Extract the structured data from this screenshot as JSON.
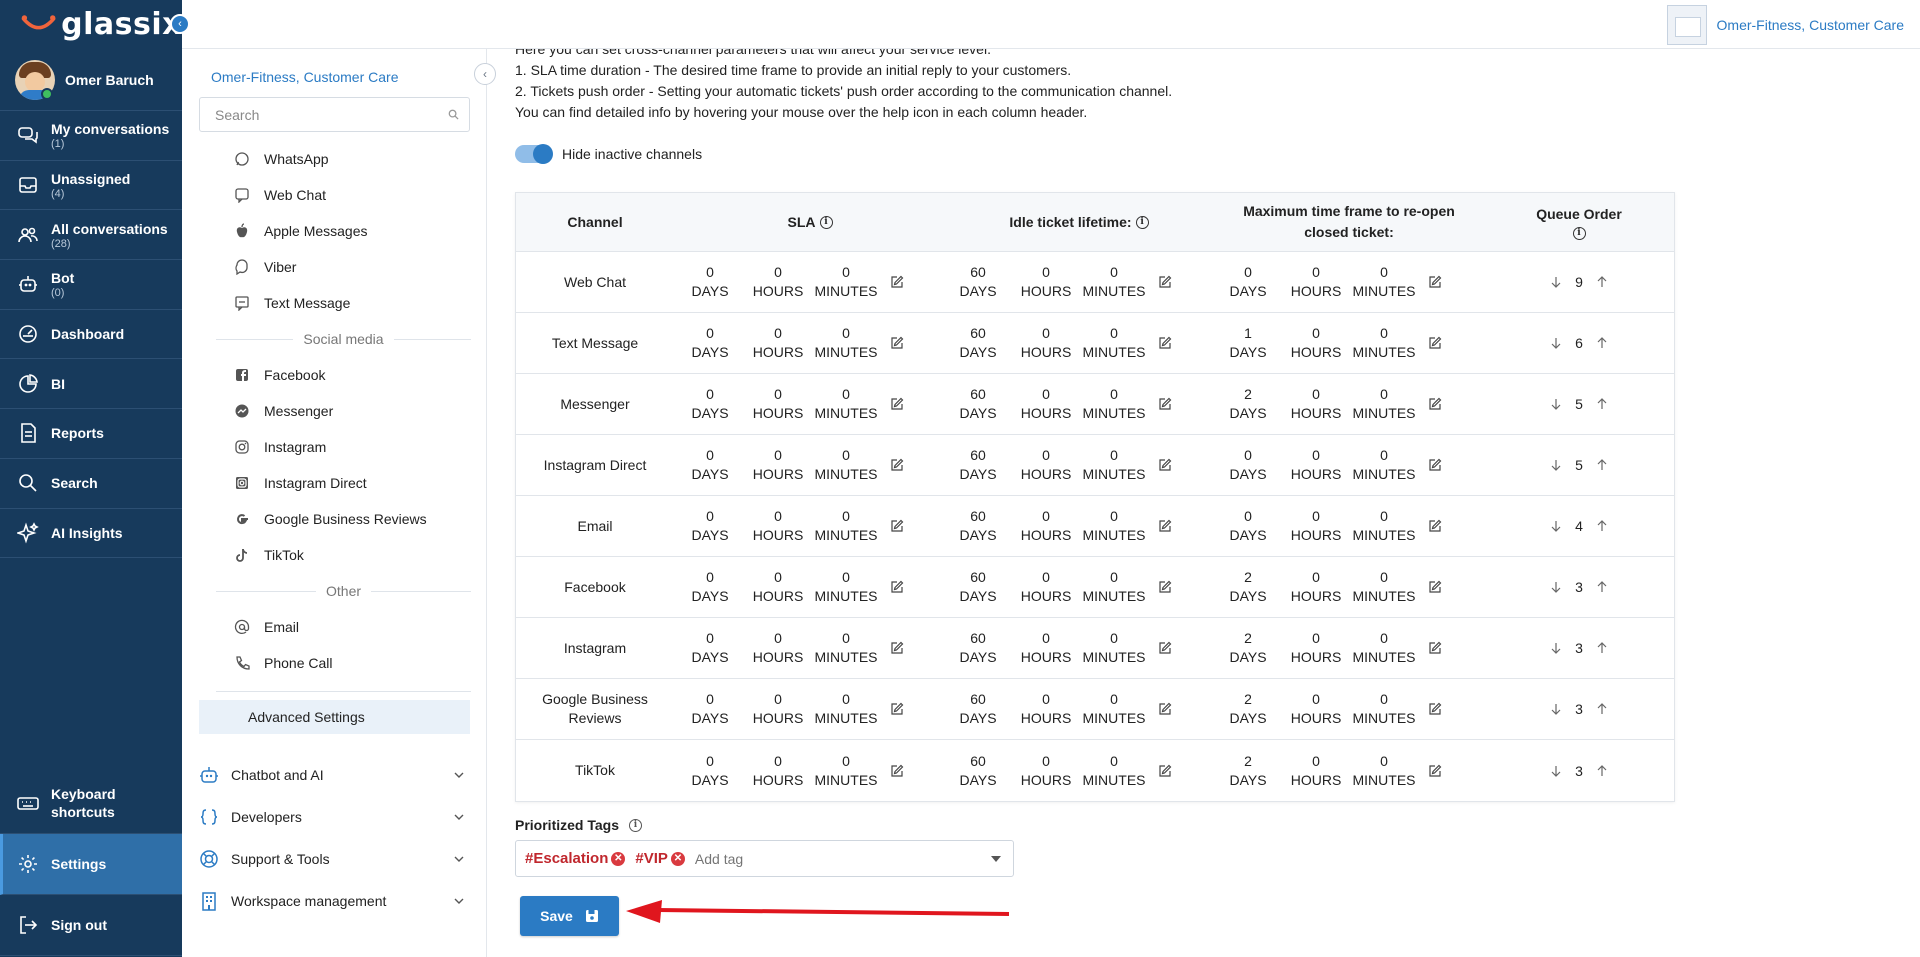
{
  "app": {
    "logo_text": "glassix",
    "org_name": "Omer-Fitness, Customer Care"
  },
  "nav": {
    "user_name": "Omer Baruch",
    "items": [
      {
        "label": "My conversations",
        "count": "(1)",
        "icon": "chat-bubbles-icon"
      },
      {
        "label": "Unassigned",
        "count": "(4)",
        "icon": "inbox-icon"
      },
      {
        "label": "All conversations",
        "count": "(28)",
        "icon": "users-icon"
      },
      {
        "label": "Bot",
        "count": "(0)",
        "icon": "robot-icon"
      },
      {
        "label": "Dashboard",
        "icon": "dashboard-icon"
      },
      {
        "label": "BI",
        "icon": "pie-chart-icon"
      },
      {
        "label": "Reports",
        "icon": "report-icon"
      },
      {
        "label": "Search",
        "icon": "search-icon"
      },
      {
        "label": "AI Insights",
        "icon": "sparkle-icon"
      }
    ],
    "bottom": [
      {
        "label": "Keyboard shortcuts",
        "icon": "keyboard-icon"
      },
      {
        "label": "Settings",
        "icon": "gear-icon",
        "active": true
      },
      {
        "label": "Sign out",
        "icon": "sign-out-icon"
      }
    ]
  },
  "sidebar": {
    "org_name": "Omer-Fitness, Customer Care",
    "search_placeholder": "Search",
    "channels": [
      {
        "label": "WhatsApp",
        "icon": "whatsapp-icon"
      },
      {
        "label": "Web Chat",
        "icon": "web-chat-icon"
      },
      {
        "label": "Apple Messages",
        "icon": "apple-icon"
      },
      {
        "label": "Viber",
        "icon": "viber-icon"
      },
      {
        "label": "Text Message",
        "icon": "sms-icon"
      }
    ],
    "social_title": "Social media",
    "social": [
      {
        "label": "Facebook",
        "icon": "facebook-icon"
      },
      {
        "label": "Messenger",
        "icon": "messenger-icon"
      },
      {
        "label": "Instagram",
        "icon": "instagram-icon"
      },
      {
        "label": "Instagram Direct",
        "icon": "instagram-direct-icon"
      },
      {
        "label": "Google Business Reviews",
        "icon": "google-icon"
      },
      {
        "label": "TikTok",
        "icon": "tiktok-icon"
      }
    ],
    "other_title": "Other",
    "other": [
      {
        "label": "Email",
        "icon": "at-icon"
      },
      {
        "label": "Phone Call",
        "icon": "phone-icon"
      }
    ],
    "advanced_label": "Advanced Settings",
    "groups": [
      {
        "label": "Chatbot and AI",
        "icon": "chatbot-icon"
      },
      {
        "label": "Developers",
        "icon": "code-braces-icon"
      },
      {
        "label": "Support & Tools",
        "icon": "lifebuoy-icon"
      },
      {
        "label": "Workspace management",
        "icon": "building-icon"
      }
    ]
  },
  "main": {
    "intro_lines": [
      "Here you can set cross-channel parameters that will affect your service level.",
      "1. SLA time duration -  The desired time frame to provide an initial reply to your customers.",
      "2. Tickets push order - Setting your automatic tickets' push order according to the communication channel.",
      "You can find detailed info by hovering your mouse over the help icon in each column header."
    ],
    "toggle_label": "Hide inactive channels",
    "toggle_on": true,
    "table": {
      "headers": {
        "channel": "Channel",
        "sla": "SLA",
        "idle": "Idle ticket lifetime:",
        "reopen": "Maximum time frame to re-open closed ticket:",
        "queue": "Queue Order"
      },
      "unit_days": "DAYS",
      "unit_hours": "HOURS",
      "unit_minutes": "MINUTES",
      "rows": [
        {
          "channel": "Web Chat",
          "sla": [
            "0",
            "0",
            "0"
          ],
          "idle": [
            "60",
            "0",
            "0"
          ],
          "reopen": [
            "0",
            "0",
            "0"
          ],
          "queue": "9"
        },
        {
          "channel": "Text Message",
          "sla": [
            "0",
            "0",
            "0"
          ],
          "idle": [
            "60",
            "0",
            "0"
          ],
          "reopen": [
            "1",
            "0",
            "0"
          ],
          "queue": "6"
        },
        {
          "channel": "Messenger",
          "sla": [
            "0",
            "0",
            "0"
          ],
          "idle": [
            "60",
            "0",
            "0"
          ],
          "reopen": [
            "2",
            "0",
            "0"
          ],
          "queue": "5"
        },
        {
          "channel": "Instagram Direct",
          "sla": [
            "0",
            "0",
            "0"
          ],
          "idle": [
            "60",
            "0",
            "0"
          ],
          "reopen": [
            "0",
            "0",
            "0"
          ],
          "queue": "5"
        },
        {
          "channel": "Email",
          "sla": [
            "0",
            "0",
            "0"
          ],
          "idle": [
            "60",
            "0",
            "0"
          ],
          "reopen": [
            "0",
            "0",
            "0"
          ],
          "queue": "4"
        },
        {
          "channel": "Facebook",
          "sla": [
            "0",
            "0",
            "0"
          ],
          "idle": [
            "60",
            "0",
            "0"
          ],
          "reopen": [
            "2",
            "0",
            "0"
          ],
          "queue": "3"
        },
        {
          "channel": "Instagram",
          "sla": [
            "0",
            "0",
            "0"
          ],
          "idle": [
            "60",
            "0",
            "0"
          ],
          "reopen": [
            "2",
            "0",
            "0"
          ],
          "queue": "3"
        },
        {
          "channel": "Google Business Reviews",
          "sla": [
            "0",
            "0",
            "0"
          ],
          "idle": [
            "60",
            "0",
            "0"
          ],
          "reopen": [
            "2",
            "0",
            "0"
          ],
          "queue": "3"
        },
        {
          "channel": "TikTok",
          "sla": [
            "0",
            "0",
            "0"
          ],
          "idle": [
            "60",
            "0",
            "0"
          ],
          "reopen": [
            "2",
            "0",
            "0"
          ],
          "queue": "3"
        }
      ]
    },
    "prioritized_tags_label": "Prioritized Tags",
    "tags": [
      "#Escalation",
      "#VIP"
    ],
    "add_tag_placeholder": "Add tag",
    "save_label": "Save"
  },
  "colors": {
    "nav_bg": "#173a5c",
    "accent": "#2b7bc4",
    "tag_red": "#c0272d",
    "annotation_arrow": "#e0161e"
  }
}
